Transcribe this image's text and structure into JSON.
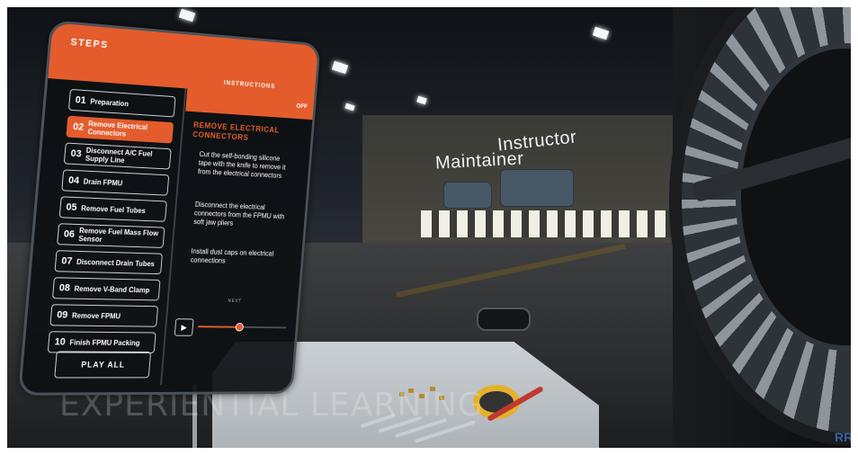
{
  "scene": {
    "watermark": "EXPERIENTIAL LEARNING",
    "avatar_labels": {
      "instructor": "Instructor",
      "maintainer": "Maintainer"
    },
    "brand_logo": "rolls-royce-icon"
  },
  "panel": {
    "steps_title": "STEPS",
    "instructions_tab": "INSTRUCTIONS",
    "toggle_label": "OFF",
    "steps": [
      {
        "num": "01",
        "label": "Preparation",
        "active": false
      },
      {
        "num": "02",
        "label": "Remove Electrical Connectors",
        "active": true
      },
      {
        "num": "03",
        "label": "Disconnect A/C Fuel Supply Line",
        "active": false
      },
      {
        "num": "04",
        "label": "Drain FPMU",
        "active": false
      },
      {
        "num": "05",
        "label": "Remove Fuel Tubes",
        "active": false
      },
      {
        "num": "06",
        "label": "Remove Fuel Mass Flow Sensor",
        "active": false
      },
      {
        "num": "07",
        "label": "Disconnect Drain Tubes",
        "active": false
      },
      {
        "num": "08",
        "label": "Remove V-Band Clamp",
        "active": false
      },
      {
        "num": "09",
        "label": "Remove FPMU",
        "active": false
      },
      {
        "num": "10",
        "label": "Finish FPMU Packing",
        "active": false
      }
    ],
    "play_all": "PLAY ALL",
    "instruction_title": "REMOVE ELECTRICAL CONNECTORS",
    "instructions": [
      "Cut the self-bonding silicone tape with the knife to remove it from the electrical connectors",
      "Disconnect the electrical connectors from the FPMU with soft jaw pliers",
      "Install dust caps on electrical connections"
    ],
    "next_label": "NEXT",
    "play_icon": "play-icon",
    "progress": 0.45,
    "accent_color": "#e45c2c"
  }
}
